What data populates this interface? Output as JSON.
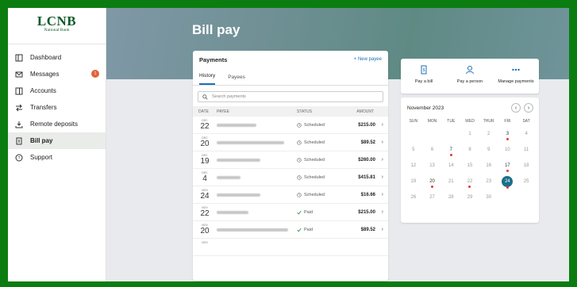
{
  "logo": {
    "name": "LCNB",
    "sub": "National Bank"
  },
  "nav": [
    {
      "label": "Dashboard",
      "icon": "dashboard-icon"
    },
    {
      "label": "Messages",
      "icon": "mail-icon",
      "badge": "1"
    },
    {
      "label": "Accounts",
      "icon": "accounts-icon"
    },
    {
      "label": "Transfers",
      "icon": "transfer-icon"
    },
    {
      "label": "Remote deposits",
      "icon": "deposit-icon"
    },
    {
      "label": "Bill pay",
      "icon": "bill-icon",
      "active": true
    },
    {
      "label": "Support",
      "icon": "help-icon"
    }
  ],
  "page": {
    "title": "Bill pay"
  },
  "payments": {
    "title": "Payments",
    "new_payee": "+ New payee",
    "tabs": [
      "History",
      "Payees"
    ],
    "search_placeholder": "Search payments",
    "columns": [
      "DATE",
      "PAYEE",
      "STATUS",
      "AMOUNT"
    ],
    "rows": [
      {
        "month": "DEC",
        "day": "22",
        "status": "Scheduled",
        "amount": "$215.00"
      },
      {
        "month": "DEC",
        "day": "20",
        "status": "Scheduled",
        "amount": "$89.52"
      },
      {
        "month": "DEC",
        "day": "19",
        "status": "Scheduled",
        "amount": "$260.00"
      },
      {
        "month": "DEC",
        "day": "4",
        "status": "Scheduled",
        "amount": "$415.81"
      },
      {
        "month": "NOV",
        "day": "24",
        "status": "Scheduled",
        "amount": "$16.66"
      },
      {
        "month": "NOV",
        "day": "22",
        "status": "Paid",
        "amount": "$215.00"
      },
      {
        "month": "NOV",
        "day": "20",
        "status": "Paid",
        "amount": "$89.52"
      },
      {
        "month": "NOV",
        "day": "",
        "status": "",
        "amount": ""
      }
    ]
  },
  "actions": [
    {
      "label": "Pay a bill",
      "icon": "bill-icon"
    },
    {
      "label": "Pay a person",
      "icon": "person-icon"
    },
    {
      "label": "Manage payments",
      "icon": "more-icon"
    }
  ],
  "calendar": {
    "month_label": "November 2023",
    "days_of_week": [
      "SUN",
      "MON",
      "TUE",
      "WED",
      "THUR",
      "FRI",
      "SAT"
    ],
    "leading_blank": 3,
    "days": [
      "1",
      "2",
      "3",
      "4",
      "5",
      "6",
      "7",
      "8",
      "9",
      "10",
      "11",
      "12",
      "13",
      "14",
      "15",
      "16",
      "17",
      "18",
      "19",
      "20",
      "21",
      "22",
      "23",
      "24",
      "25",
      "26",
      "27",
      "28",
      "29",
      "30"
    ],
    "marked_days": [
      "3",
      "7",
      "17",
      "20",
      "22"
    ],
    "today": "24",
    "dark_days": [
      "3",
      "7",
      "17",
      "20",
      "24"
    ]
  },
  "colors": {
    "brand": "#0f5a2a",
    "accent": "#1f6fb2",
    "today": "#1c6e8a",
    "dot": "#e23a2c"
  }
}
